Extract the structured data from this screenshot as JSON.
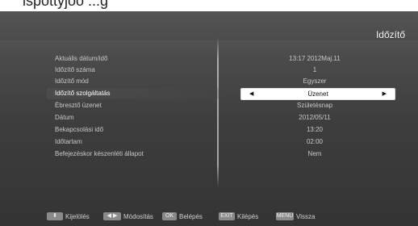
{
  "top_clip_text": "ispottyjoo  ...g",
  "title": "Időzítő",
  "rows": [
    {
      "label": "Aktuális dátum/idő",
      "value": "13:17 2012Maj.11"
    },
    {
      "label": "Időzítő száma",
      "value": "1"
    },
    {
      "label": "Időzítő mód",
      "value": "Egyszer"
    },
    {
      "label": "Időzítő szolgáltatás",
      "value": "Üzenet"
    },
    {
      "label": "Ébresztő üzenet",
      "value": "Születésnap"
    },
    {
      "label": "Dátum",
      "value": "2012/05/11"
    },
    {
      "label": "Bekapcsolási idő",
      "value": "13:20"
    },
    {
      "label": "Időtartam",
      "value": "02:00"
    },
    {
      "label": "Befejezéskor készenléti állapot",
      "value": "Nem"
    }
  ],
  "selected_row": 3,
  "footer": {
    "select": {
      "key": "⬍",
      "label": "Kijelölés"
    },
    "modify": {
      "key": "◀ ▶",
      "label": "Módosítás"
    },
    "enter": {
      "key": "OK",
      "label": "Belépés"
    },
    "exit": {
      "key": "EXIT",
      "label": "Kilépés"
    },
    "back": {
      "key": "MENU",
      "label": "Vissza"
    }
  },
  "colors": {
    "background": "#3d3d3d",
    "selected_box": "#ffffff",
    "key_bg": "#8a8a8a"
  }
}
